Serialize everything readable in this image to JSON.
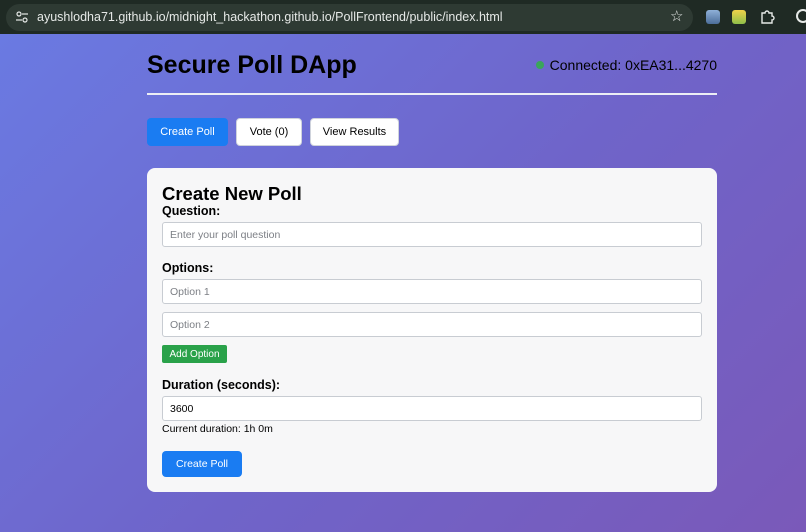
{
  "browser": {
    "url": "ayushlodha71.github.io/midnight_hackathon.github.io/PollFrontend/public/index.html"
  },
  "app": {
    "title": "Secure Poll DApp",
    "connection_status": "Connected: 0xEA31...4270",
    "status_color": "#3aa55a"
  },
  "nav": {
    "create_label": "Create Poll",
    "vote_label": "Vote (0)",
    "results_label": "View Results"
  },
  "form": {
    "title": "Create New Poll",
    "question_label": "Question:",
    "question_placeholder": "Enter your poll question",
    "options_label": "Options:",
    "option_placeholders": [
      "Option 1",
      "Option 2"
    ],
    "add_option_label": "Add Option",
    "duration_label": "Duration (seconds):",
    "duration_value": "3600",
    "current_duration": "Current duration: 1h 0m",
    "submit_label": "Create Poll"
  },
  "colors": {
    "primary": "#1a7cf2",
    "success": "#2aa24a"
  }
}
